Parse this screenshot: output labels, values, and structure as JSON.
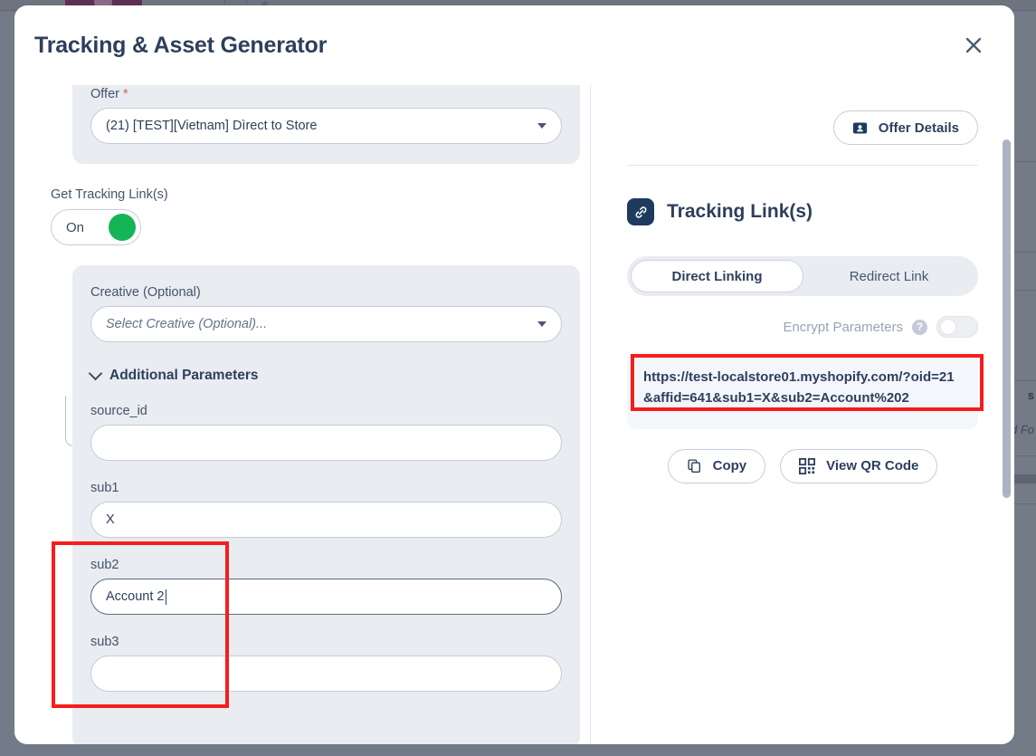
{
  "modal": {
    "title": "Tracking & Asset Generator",
    "close_label": "×"
  },
  "left": {
    "offer": {
      "label": "Offer",
      "required_mark": "*",
      "value": "(21) [TEST][Vietnam] Dìrect to Store"
    },
    "tracking_toggle": {
      "label": "Get Tracking Link(s)",
      "state": "On"
    },
    "creative": {
      "label": "Creative (Optional)",
      "placeholder": "Select Creative (Optional)..."
    },
    "additional_parameters": {
      "title": "Additional Parameters"
    },
    "params": [
      {
        "label": "source_id",
        "value": ""
      },
      {
        "label": "sub1",
        "value": "X"
      },
      {
        "label": "sub2",
        "value": "Account 2"
      },
      {
        "label": "sub3",
        "value": ""
      }
    ]
  },
  "right": {
    "offer_details_button": "Offer Details",
    "offer_details_icon": "id-badge-icon",
    "section_title": "Tracking Link(s)",
    "section_icon": "link-chain-icon",
    "tabs": [
      {
        "label": "Direct Linking",
        "active": true
      },
      {
        "label": "Redirect Link",
        "active": false
      }
    ],
    "encrypt": {
      "label": "Encrypt Parameters",
      "help_glyph": "?",
      "state": "off"
    },
    "tracking_url": "https://test-localstore01.myshopify.com/?oid=21&affid=641&sub1=X&sub2=Account%202",
    "actions": [
      {
        "label": "Copy",
        "icon": "copy-icon"
      },
      {
        "label": "View QR Code",
        "icon": "qr-code-icon"
      }
    ]
  },
  "background": {
    "text_fragment_1": "s",
    "text_fragment_2": "d Fo"
  },
  "colors": {
    "accent_navy": "#2e3f5c",
    "toggle_green": "#14b457",
    "annotation_red": "#f61d1d",
    "card_gray": "#e9ecf1",
    "url_box_bg": "#f3f7fc"
  }
}
